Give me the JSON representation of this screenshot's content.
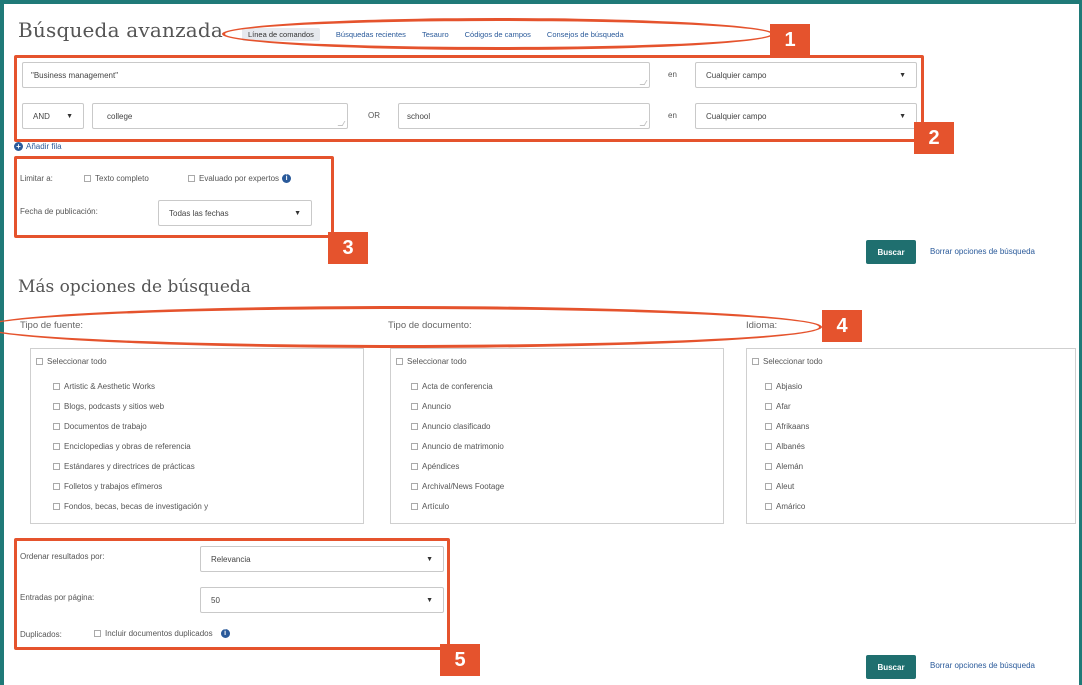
{
  "page": {
    "title": "Búsqueda avanzada",
    "more_title": "Más opciones de búsqueda"
  },
  "nav": [
    {
      "label": "Línea de comandos",
      "active": true
    },
    {
      "label": "Búsquedas recientes"
    },
    {
      "label": "Tesauro"
    },
    {
      "label": "Códigos de campos"
    },
    {
      "label": "Consejos de búsqueda"
    }
  ],
  "search": {
    "row1": {
      "value": "\"Business management\"",
      "in_label": "en",
      "field": "Cualquier campo"
    },
    "row2": {
      "operator": "AND",
      "value1": "college",
      "or_label": "OR",
      "value2": "school",
      "in_label": "en",
      "field": "Cualquier campo"
    },
    "add_row": "Añadir fila"
  },
  "limit": {
    "label": "Limitar a:",
    "fulltext": "Texto completo",
    "peer": "Evaluado por expertos",
    "date_label": "Fecha de publicación:",
    "date_value": "Todas las fechas"
  },
  "actions": {
    "search": "Buscar",
    "clear": "Borrar opciones de búsqueda"
  },
  "columns": {
    "source": {
      "label": "Tipo de fuente:",
      "select_all": "Seleccionar todo",
      "items": [
        "Artistic & Aesthetic Works",
        "Blogs, podcasts y sitios web",
        "Documentos de trabajo",
        "Enciclopedias y obras de referencia",
        "Estándares y directrices de prácticas",
        "Folletos y trabajos efímeros",
        "Fondos, becas, becas de investigación y"
      ]
    },
    "doctype": {
      "label": "Tipo de documento:",
      "select_all": "Seleccionar todo",
      "items": [
        "Acta de conferencia",
        "Anuncio",
        "Anuncio clasificado",
        "Anuncio de matrimonio",
        "Apéndices",
        "Archival/News Footage",
        "Artículo"
      ]
    },
    "language": {
      "label": "Idioma:",
      "select_all": "Seleccionar todo",
      "items": [
        "Abjasio",
        "Afar",
        "Afrikaans",
        "Albanés",
        "Alemán",
        "Aleut",
        "Amárico"
      ]
    }
  },
  "sort": {
    "sort_label": "Ordenar resultados por:",
    "sort_value": "Relevancia",
    "per_page_label": "Entradas por página:",
    "per_page_value": "50",
    "dup_label": "Duplicados:",
    "dup_option": "Incluir documentos duplicados"
  },
  "annotations": [
    "1",
    "2",
    "3",
    "4",
    "5"
  ],
  "colors": {
    "accent": "#1f7a78",
    "annotation": "#e5532d",
    "link": "#2a5a9a"
  },
  "icons": {
    "info": "info-icon",
    "add": "plus-circle-icon",
    "dropdown": "caret-down-icon"
  }
}
